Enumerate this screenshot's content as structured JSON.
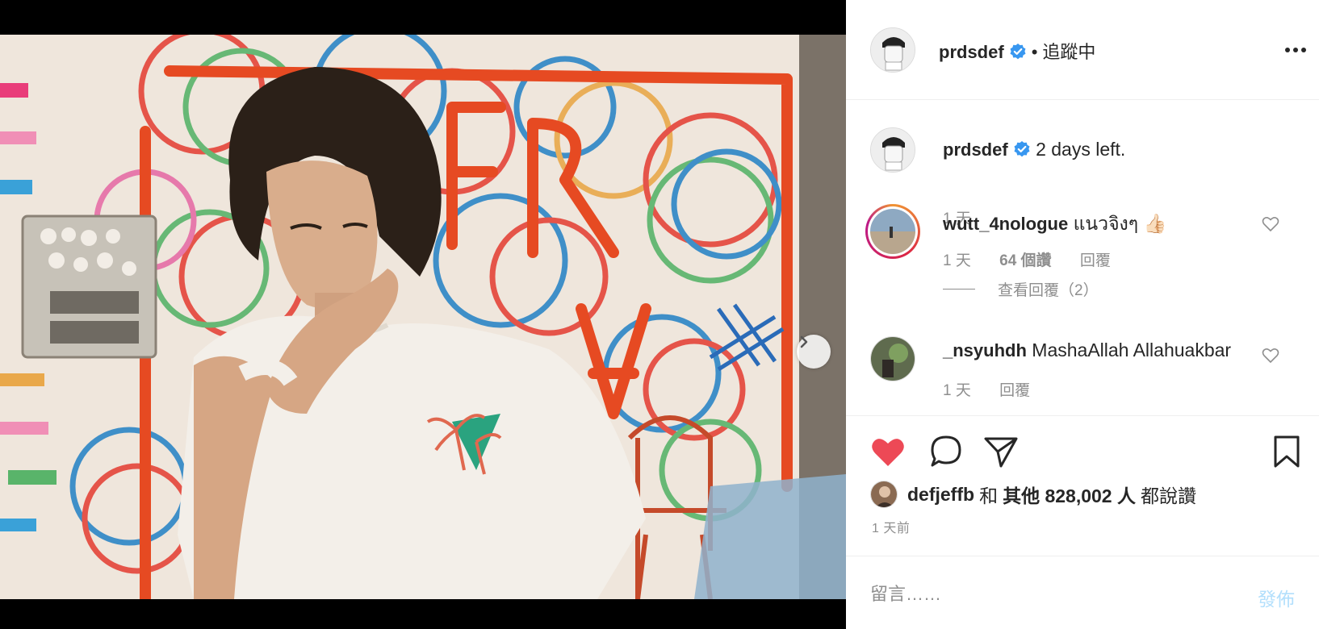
{
  "post": {
    "username": "prdsdef",
    "follow_sep": "•",
    "follow_status": "追蹤中",
    "more_icon": "more-horizontal-icon",
    "carousel": {
      "current": 1,
      "total": 2
    }
  },
  "caption": {
    "username": "prdsdef",
    "text": "2 days left.",
    "time": "1 天"
  },
  "comments": [
    {
      "username": "wutt_4nologue",
      "text": "แนวจิงๆ 👍🏻",
      "time": "1 天",
      "likes": "64 個讚",
      "reply": "回覆",
      "view_replies": "查看回覆（2）"
    },
    {
      "username": "_nsyuhdh",
      "text": "MashaAllah Allahuakbar",
      "time": "1 天",
      "reply": "回覆"
    }
  ],
  "likes": {
    "username": "defjeffb",
    "and": "和",
    "others": "其他 828,002 人",
    "suffix": "都說讚",
    "time_ago": "1 天前"
  },
  "comment_box": {
    "placeholder": "留言……",
    "post_label": "發佈"
  },
  "colors": {
    "like_red": "#ed4956",
    "verified_blue": "#3897f0",
    "post_disabled": "#b2dffc"
  }
}
